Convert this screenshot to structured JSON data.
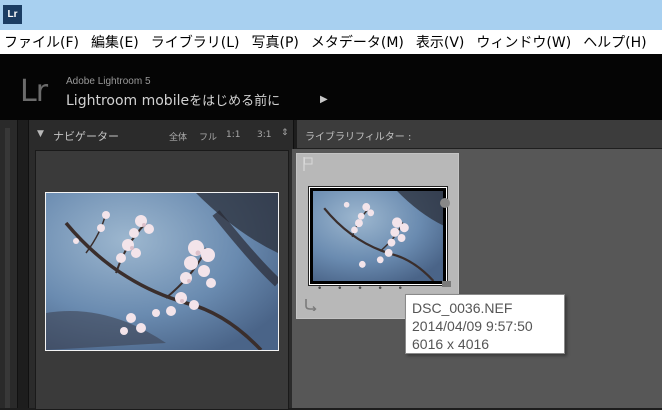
{
  "titlebar": {
    "app_icon_text": "Lr"
  },
  "menubar": {
    "items": [
      {
        "label": "ファイル(F)"
      },
      {
        "label": "編集(E)"
      },
      {
        "label": "ライブラリ(L)"
      },
      {
        "label": "写真(P)"
      },
      {
        "label": "メタデータ(M)"
      },
      {
        "label": "表示(V)"
      },
      {
        "label": "ウィンドウ(W)"
      },
      {
        "label": "ヘルプ(H)"
      }
    ]
  },
  "identity": {
    "logo_text": "Lr",
    "product_name": "Adobe Lightroom 5",
    "mobile_text": "Lightroom mobile",
    "mobile_suffix": "をはじめる前に",
    "arrow": "▶"
  },
  "navigator": {
    "collapse_triangle": "▼",
    "title": "ナビゲーター",
    "zoom_options": [
      "全体",
      "フル",
      "1:1",
      "3:1"
    ],
    "zoom_arrow": "⇕"
  },
  "library_filter": {
    "label": "ライブラリフィルター :"
  },
  "grid": {
    "cell": {
      "rating_dots": "• • • • •"
    }
  },
  "tooltip": {
    "filename": "DSC_0036.NEF",
    "datetime": "2014/04/09 9:57:50",
    "dimensions": "6016 x 4016"
  },
  "colors": {
    "titlebar": "#a8d0f0",
    "identity_bg": "#050505",
    "panel_bg": "#2b2b2b",
    "grid_bg": "#575757",
    "cell_bg": "#b8b8b8",
    "sky": "#6d8fb2",
    "blossom": "#f2e6ea"
  }
}
